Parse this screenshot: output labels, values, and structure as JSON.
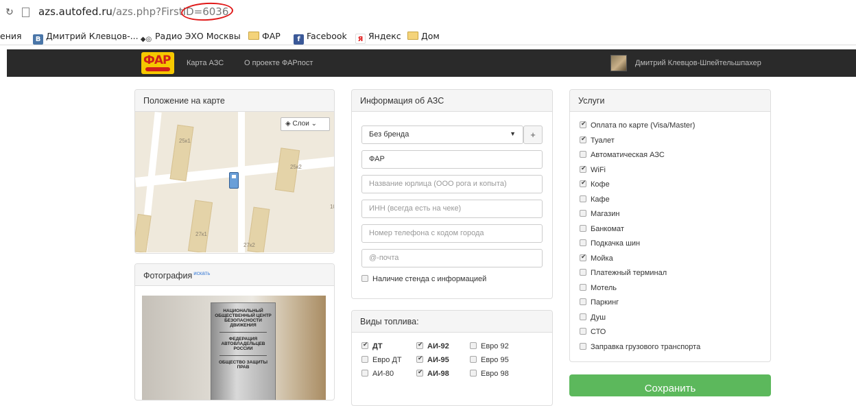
{
  "browser": {
    "url_host": "azs.autofed.ru",
    "url_path": "/azs.php?FirstID=6036",
    "bookmarks": [
      {
        "label": "ения",
        "icon": "none"
      },
      {
        "label": "Дмитрий Клевцов-...",
        "icon": "vk-icon"
      },
      {
        "label": "Радио ЭХО Москвы",
        "icon": "echo-icon"
      },
      {
        "label": "ФАР",
        "icon": "folder-icon"
      },
      {
        "label": "Facebook",
        "icon": "facebook-icon"
      },
      {
        "label": "Яндекс",
        "icon": "yandex-icon"
      },
      {
        "label": "Дом",
        "icon": "folder-icon"
      }
    ]
  },
  "navbar": {
    "logo_text": "ФАР",
    "links": [
      "Карта АЗС",
      "О проекте ФАРпост"
    ],
    "user_name": "Дмитрий Клевцов-Шпейтельшпахер"
  },
  "map_panel": {
    "title": "Положение на карте",
    "layers_label": "Слои",
    "labels": [
      "25к1",
      "25к2",
      "27к1",
      "27к2",
      "10"
    ]
  },
  "photo_panel": {
    "title": "Фотография",
    "search_link": "искать",
    "plaque_lines": [
      "НАЦИОНАЛЬНЫЙ ОБЩЕСТВЕННЫЙ ЦЕНТР БЕЗОПАСНОСТИ ДВИЖЕНИЯ",
      "ФЕДЕРАЦИЯ АВТОВЛАДЕЛЬЦЕВ РОССИИ",
      "ОБЩЕСТВО ЗАЩИТЫ ПРАВ"
    ]
  },
  "info_panel": {
    "title": "Информация об АЗС",
    "brand_select": "Без бренда",
    "add_button": "+",
    "name_value": "ФАР",
    "legal_placeholder": "Название юрлица (ООО рога и копыта)",
    "inn_placeholder": "ИНН (всегда есть на чеке)",
    "phone_placeholder": "Номер телефона с кодом города",
    "email_placeholder": "@-почта",
    "stand_label": "Наличие стенда с информацией",
    "stand_checked": false
  },
  "fuel_panel": {
    "title": "Виды топлива:",
    "items": [
      {
        "label": "ДТ",
        "checked": true,
        "bold": true
      },
      {
        "label": "АИ-92",
        "checked": true,
        "bold": true
      },
      {
        "label": "Евро 92",
        "checked": false,
        "bold": false
      },
      {
        "label": "Евро ДТ",
        "checked": false,
        "bold": false
      },
      {
        "label": "АИ-95",
        "checked": true,
        "bold": true
      },
      {
        "label": "Евро 95",
        "checked": false,
        "bold": false
      },
      {
        "label": "АИ-80",
        "checked": false,
        "bold": false
      },
      {
        "label": "АИ-98",
        "checked": true,
        "bold": true
      },
      {
        "label": "Евро 98",
        "checked": false,
        "bold": false
      }
    ]
  },
  "services_panel": {
    "title": "Услуги",
    "items": [
      {
        "label": "Оплата по карте (Visa/Master)",
        "checked": true
      },
      {
        "label": "Туалет",
        "checked": true
      },
      {
        "label": "Автоматическая АЗС",
        "checked": false
      },
      {
        "label": "WiFi",
        "checked": true
      },
      {
        "label": "Кофе",
        "checked": true
      },
      {
        "label": "Кафе",
        "checked": false
      },
      {
        "label": "Магазин",
        "checked": false
      },
      {
        "label": "Банкомат",
        "checked": false
      },
      {
        "label": "Подкачка шин",
        "checked": false
      },
      {
        "label": "Мойка",
        "checked": true
      },
      {
        "label": "Платежный терминал",
        "checked": false
      },
      {
        "label": "Мотель",
        "checked": false
      },
      {
        "label": "Паркинг",
        "checked": false
      },
      {
        "label": "Душ",
        "checked": false
      },
      {
        "label": "СТО",
        "checked": false
      },
      {
        "label": "Заправка грузового транспорта",
        "checked": false
      }
    ]
  },
  "save_button": "Сохранить",
  "colors": {
    "navbar": "#2a2a2a",
    "save": "#5cb85c",
    "logo_bg": "#f5c800",
    "logo_fg": "#d0201a",
    "annotation_circle": "#e01818"
  }
}
